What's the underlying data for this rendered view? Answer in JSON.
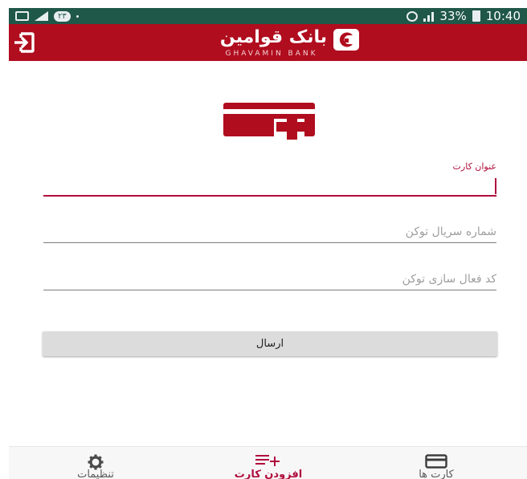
{
  "status_bar": {
    "notification_badge": "۲۳",
    "battery_percent": "33%",
    "time": "10:40"
  },
  "app_bar": {
    "exit_icon": "exit-icon",
    "logo": {
      "name": "بانک قوامین",
      "subtitle": "GHAVAMIN BANK"
    }
  },
  "form": {
    "header_icon": "add-card-icon",
    "fields": [
      {
        "label": "عنوان کارت",
        "value": "",
        "placeholder": ""
      },
      {
        "label": "",
        "value": "",
        "placeholder": "شماره سریال توکن"
      },
      {
        "label": "",
        "value": "",
        "placeholder": "کد فعال سازی توکن"
      }
    ],
    "submit_label": "ارسال"
  },
  "bottom_nav": {
    "items": [
      {
        "label": "کارت ها",
        "icon": "card-icon",
        "active": false
      },
      {
        "label": "افزودن کارت",
        "icon": "add-list-icon",
        "active": true
      },
      {
        "label": "تنظیمات",
        "icon": "gear-icon",
        "active": false
      }
    ]
  },
  "colors": {
    "primary": "#b00d1e",
    "accent": "#b00d3d",
    "status_bar": "#1f5748"
  }
}
